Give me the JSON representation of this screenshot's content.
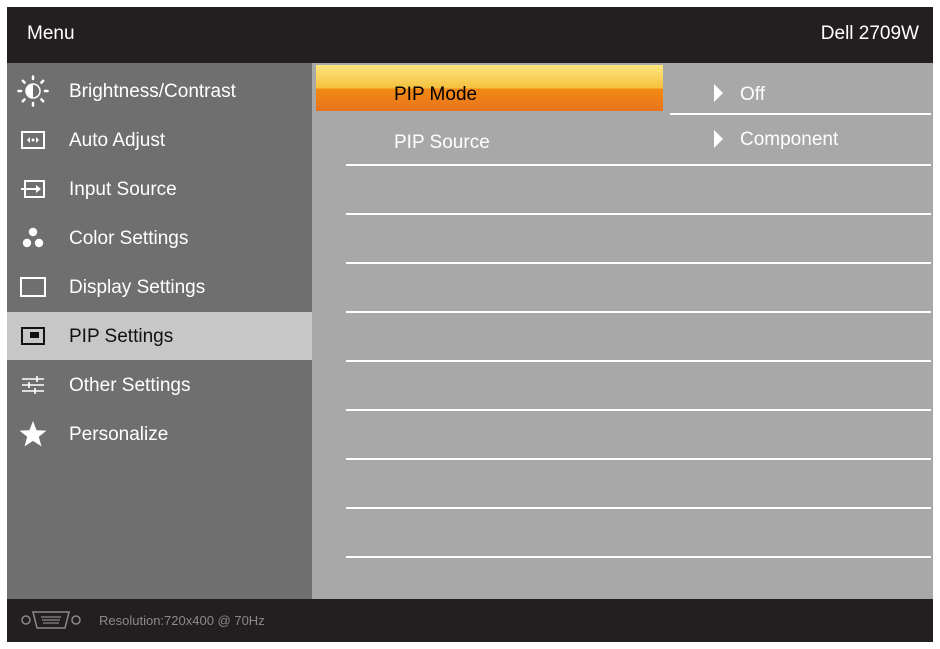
{
  "header": {
    "menu_label": "Menu",
    "model": "Dell 2709W"
  },
  "sidebar": {
    "items": [
      {
        "label": "Brightness/Contrast",
        "icon": "brightness-icon"
      },
      {
        "label": "Auto Adjust",
        "icon": "auto-adjust-icon"
      },
      {
        "label": "Input Source",
        "icon": "input-source-icon"
      },
      {
        "label": "Color Settings",
        "icon": "color-settings-icon"
      },
      {
        "label": "Display Settings",
        "icon": "display-settings-icon"
      },
      {
        "label": "PIP Settings",
        "icon": "pip-icon",
        "active": true
      },
      {
        "label": "Other Settings",
        "icon": "sliders-icon"
      },
      {
        "label": "Personalize",
        "icon": "star-icon"
      }
    ]
  },
  "options": [
    {
      "name": "PIP Mode",
      "value": "Off",
      "selected": true
    },
    {
      "name": "PIP Source",
      "value": "Component",
      "selected": false
    }
  ],
  "footer": {
    "resolution": "Resolution:720x400 @ 70Hz",
    "connector_icon": "vga-connector-icon"
  },
  "colors": {
    "highlight_top": "#fde680",
    "highlight_bottom": "#e8731c",
    "sidebar_bg": "#6f6f6f",
    "content_bg": "#a8a8a8",
    "active_item_bg": "#c7c7c7"
  }
}
